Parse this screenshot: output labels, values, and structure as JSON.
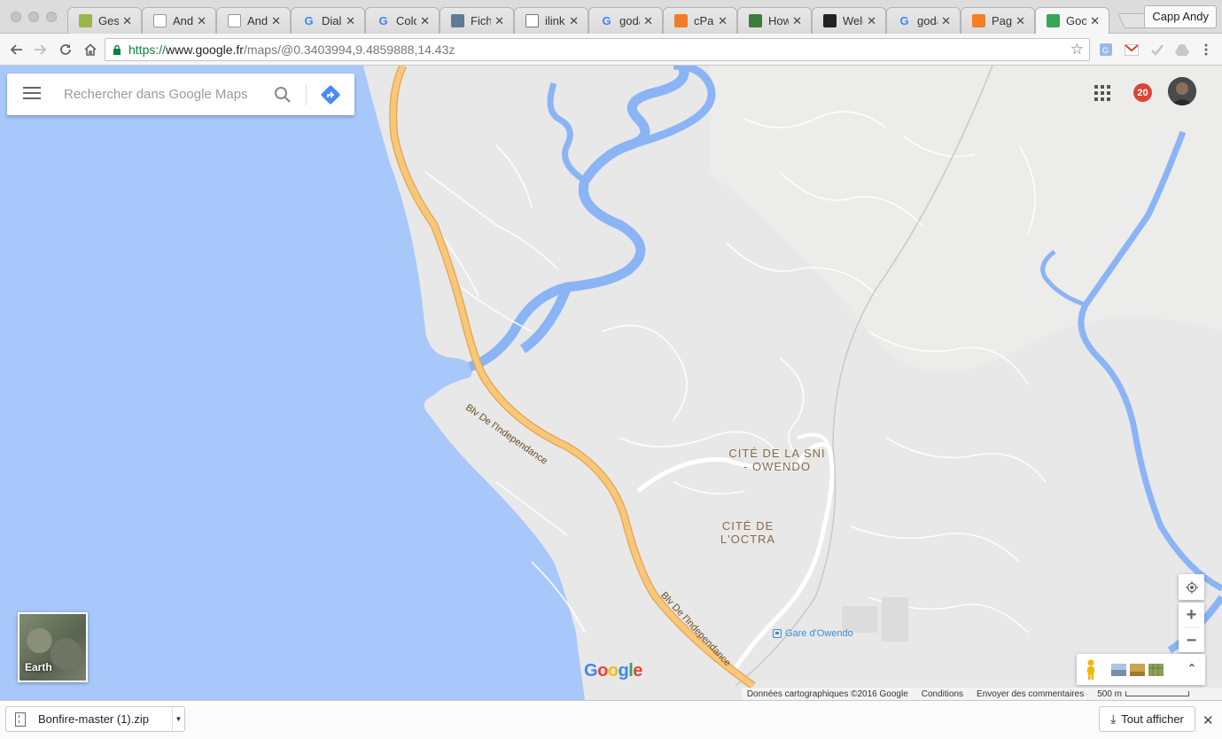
{
  "tabs": [
    {
      "title": "Gesti",
      "icon": "android-studio-icon",
      "color": "#9bb54a"
    },
    {
      "title": "Andr",
      "icon": "document-icon",
      "color": "#999999"
    },
    {
      "title": "Andr",
      "icon": "document-icon",
      "color": "#999999"
    },
    {
      "title": "Dialo",
      "icon": "google-icon",
      "color": "#4285f4"
    },
    {
      "title": "Color",
      "icon": "google-icon",
      "color": "#4285f4"
    },
    {
      "title": "Fichi",
      "icon": "play-console-icon",
      "color": "#5f7a98"
    },
    {
      "title": "ilink v",
      "icon": "page-icon",
      "color": "#777777"
    },
    {
      "title": "goda",
      "icon": "google-icon",
      "color": "#4285f4"
    },
    {
      "title": "cPan",
      "icon": "cpanel-icon",
      "color": "#f07c2a"
    },
    {
      "title": "How",
      "icon": "how-icon",
      "color": "#3b7d3b"
    },
    {
      "title": "Welc",
      "icon": "welcome-icon",
      "color": "#222222"
    },
    {
      "title": "goda",
      "icon": "google-icon",
      "color": "#4285f4"
    },
    {
      "title": "Page",
      "icon": "stackoverflow-icon",
      "color": "#f48024"
    },
    {
      "title": "Goog",
      "icon": "google-maps-icon",
      "color": "#34a853",
      "active": true
    }
  ],
  "profile": {
    "name": "Capp Andy"
  },
  "address_bar": {
    "scheme": "https://",
    "host": "www.google.fr",
    "path": "/maps/@0.3403994,9.4859888,14.43z"
  },
  "maps": {
    "search_placeholder": "Rechercher dans Google Maps",
    "notification_count": "20",
    "labels": {
      "cite_sni_line1": "CITÉ DE LA SNI",
      "cite_sni_line2": "- OWENDO",
      "cite_octra_line1": "CITÉ DE",
      "cite_octra_line2": "L'OCTRA",
      "station": "Gare d'Owendo",
      "road_upper": "Blv De l'Independance",
      "road_lower": "Blv De l'Independance"
    },
    "earth_label": "Earth",
    "logo": "Google",
    "attribution": {
      "data": "Données cartographiques ©2016 Google",
      "terms": "Conditions",
      "feedback": "Envoyer des commentaires",
      "scale": "500 m"
    },
    "colors": {
      "water": "#a8c8fb",
      "land": "#e8e8e8",
      "highway": "#f8c77b",
      "river": "#8ab4f5"
    }
  },
  "downloads": {
    "file_name": "Bonfire-master (1).zip",
    "show_all": "Tout afficher"
  }
}
